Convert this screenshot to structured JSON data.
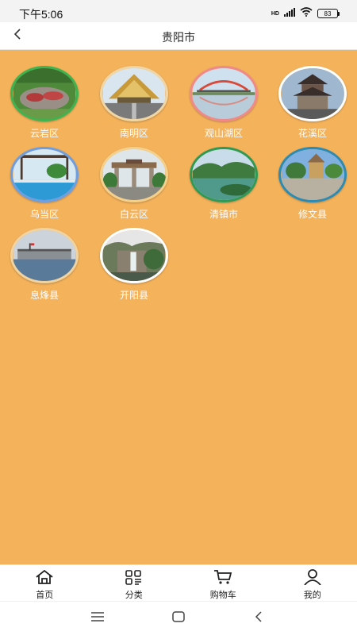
{
  "status_bar": {
    "time": "下午5:06",
    "network": "HD",
    "battery": "83"
  },
  "header": {
    "title": "贵阳市"
  },
  "districts": [
    {
      "label": "云岩区",
      "border": "#3fb34f",
      "icon": "garden-photo"
    },
    {
      "label": "南明区",
      "border": "#f0d6a4",
      "icon": "gate-photo"
    },
    {
      "label": "观山湖区",
      "border": "#f08a8a",
      "icon": "bridge-photo"
    },
    {
      "label": "花溪区",
      "border": "#ffffff",
      "icon": "pavilion-photo"
    },
    {
      "label": "乌当区",
      "border": "#6f9ee0",
      "icon": "pool-photo"
    },
    {
      "label": "白云区",
      "border": "#f5d08a",
      "icon": "archway-photo"
    },
    {
      "label": "清镇市",
      "border": "#2f9a56",
      "icon": "lake-photo"
    },
    {
      "label": "修文县",
      "border": "#2b8bb3",
      "icon": "square-photo"
    },
    {
      "label": "息烽县",
      "border": "#f1d3a0",
      "icon": "building-photo"
    },
    {
      "label": "开阳县",
      "border": "#ffffff",
      "icon": "waterfall-photo"
    }
  ],
  "tabbar": {
    "tabs": [
      {
        "label": "首页",
        "icon": "home-icon"
      },
      {
        "label": "分类",
        "icon": "category-icon"
      },
      {
        "label": "购物车",
        "icon": "cart-icon"
      },
      {
        "label": "我的",
        "icon": "profile-icon"
      }
    ]
  }
}
